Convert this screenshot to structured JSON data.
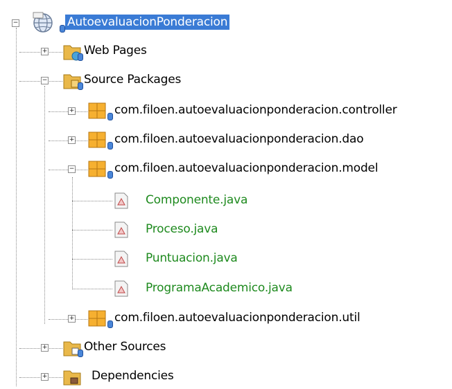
{
  "tree": {
    "root": {
      "label": "AutoevaluacionPonderacion",
      "icon": "web-project-globe-icon"
    },
    "web_pages": {
      "label": "Web Pages",
      "icon": "web-pages-folder-icon"
    },
    "source_packages": {
      "label": "Source Packages",
      "icon": "source-packages-folder-icon"
    },
    "packages": [
      {
        "label": "com.filoen.autoevaluacionponderacion.controller",
        "icon": "java-package-icon"
      },
      {
        "label": "com.filoen.autoevaluacionponderacion.dao",
        "icon": "java-package-icon"
      },
      {
        "label": "com.filoen.autoevaluacionponderacion.model",
        "icon": "java-package-icon"
      },
      {
        "label": "com.filoen.autoevaluacionponderacion.util",
        "icon": "java-package-icon"
      }
    ],
    "model_files": [
      {
        "label": "Componente.java",
        "icon": "java-file-icon"
      },
      {
        "label": "Proceso.java",
        "icon": "java-file-icon"
      },
      {
        "label": "Puntuacion.java",
        "icon": "java-file-icon"
      },
      {
        "label": "ProgramaAcademico.java",
        "icon": "java-file-icon"
      }
    ],
    "other_sources": {
      "label": "Other Sources",
      "icon": "other-sources-folder-icon"
    },
    "dependencies": {
      "label": "Dependencies",
      "icon": "dependencies-icon"
    },
    "expand_symbol": "+",
    "collapse_symbol": "−",
    "colors": {
      "selection": "#3a7bd5",
      "file_text": "#1e8a1e",
      "package_orange": "#f0a020"
    }
  }
}
